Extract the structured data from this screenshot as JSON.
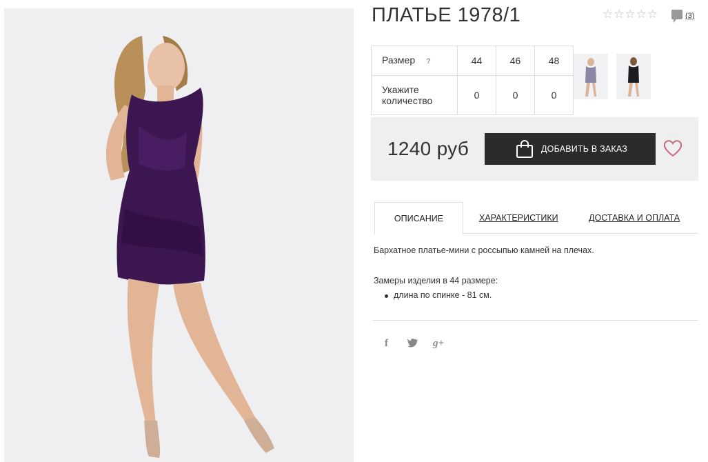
{
  "product": {
    "title": "ПЛАТЬЕ 1978/1"
  },
  "rating": {
    "stars": [
      "☆",
      "☆",
      "☆",
      "☆",
      "☆"
    ],
    "comments_count": "(3)"
  },
  "sizes": {
    "size_label": "Размер",
    "help": "?",
    "qty_label": "Укажите количество",
    "sizes": [
      "44",
      "46",
      "48"
    ],
    "quantities": [
      "0",
      "0",
      "0"
    ]
  },
  "purchase": {
    "price": "1240 руб",
    "add_button": "ДОБАВИТЬ В ЗАКАЗ"
  },
  "tabs": [
    {
      "label": "ОПИСАНИЕ",
      "active": true
    },
    {
      "label": "ХАРАКТЕРИСТИКИ",
      "active": false
    },
    {
      "label": "ДОСТАВКА И ОПЛАТА",
      "active": false
    }
  ],
  "description": {
    "text": "Бархатное платье-мини с россыпью камней на плечах.",
    "measurements_title": "Замеры изделия в 44 размере:",
    "measurements": [
      "длина по спинке - 81 см."
    ]
  },
  "social": {
    "facebook": "f",
    "twitter": "t",
    "googleplus": "g+"
  },
  "colors": {
    "dress": "#3c1650",
    "button": "#2b2b2b",
    "heart": "#c96a7e"
  }
}
